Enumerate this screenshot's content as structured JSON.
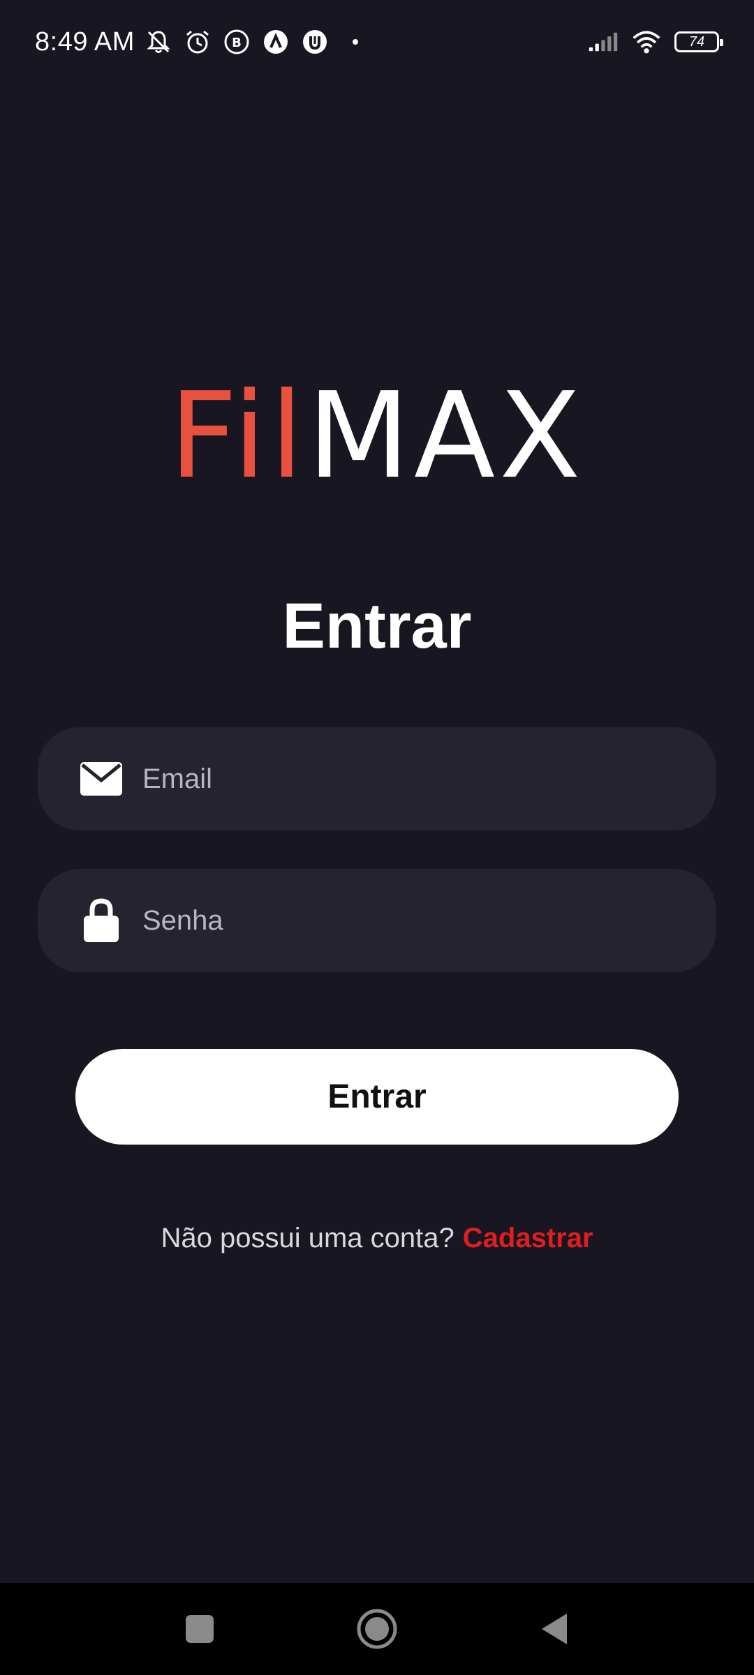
{
  "status_bar": {
    "time": "8:49 AM",
    "battery": "74",
    "icons": [
      "mute-icon",
      "alarm-icon",
      "b-app-icon",
      "a-app-icon",
      "u-app-icon",
      "signal-icon",
      "wifi-icon",
      "battery-icon"
    ]
  },
  "logo": {
    "part_red": "Fil",
    "part_white": "MAX"
  },
  "page": {
    "title": "Entrar"
  },
  "form": {
    "email_placeholder": "Email",
    "password_placeholder": "Senha",
    "email_icon": "mail-icon",
    "password_icon": "lock-icon",
    "submit_label": "Entrar"
  },
  "register": {
    "prompt": "Não possui uma conta?",
    "link_label": "Cadastrar"
  },
  "nav": {
    "icons": [
      "recents-icon",
      "home-icon",
      "back-icon"
    ]
  },
  "colors": {
    "background": "#171621",
    "field_bg": "#24232f",
    "logo_red": "#e8503f",
    "link_red": "#e01e1e"
  }
}
